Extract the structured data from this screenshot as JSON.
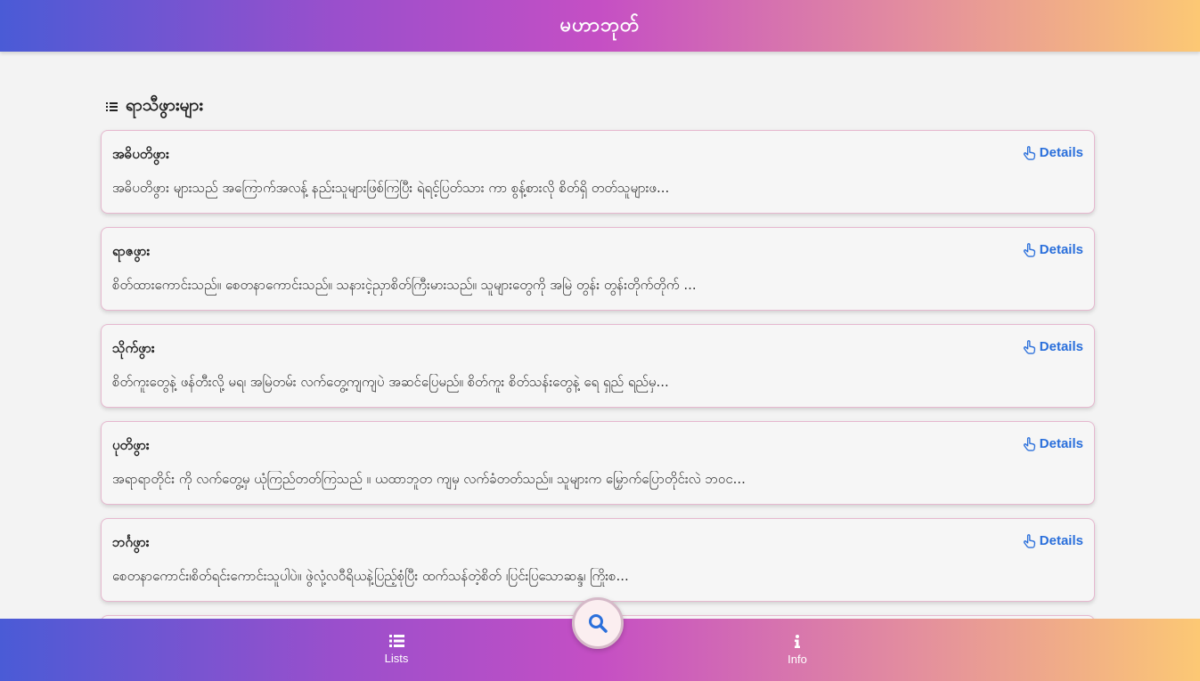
{
  "header": {
    "title": "မဟာဘုတ်"
  },
  "section": {
    "label": "ရာသီဖွားများ",
    "icon": "list-icon"
  },
  "cards": [
    {
      "title": "အဓိပတိဖွား",
      "description": "အဓိပတိဖွား များသည် အကြောက်အလန့် နည်းသူများဖြစ်ကြပြီး ရဲရင့်ပြတ်သား ကာ စွန့်စားလို စိတ်ရှိ တတ်သူများဖ...",
      "details_label": "Details"
    },
    {
      "title": "ရာဇဖွား",
      "description": "စိတ်ထားကောင်းသည်။ စေတနာကောင်းသည်။ သနားငဲ့ညှာစိတ်ကြီးမားသည်။ သူများတွေကို အမြဲ တွန်း တွန်းတိုက်တိုက် ...",
      "details_label": "Details"
    },
    {
      "title": "သိုက်ဖွား",
      "description": "စိတ်ကူးတွေနဲ့ ဖန်တီးလို့ မရ၊ အမြဲတမ်း လက်တွေ့ကျကျပဲ အဆင်ပြေမည်။ စိတ်ကူး စိတ်သန်းတွေနဲ့ ရေ ရှည် ရည်မှ...",
      "details_label": "Details"
    },
    {
      "title": "ပုတိဖွား",
      "description": "အရာရာတိုင်း ကို လက်တွေ့မှ ယုံကြည်တတ်ကြသည် ။ ယထာဘူတ ကျမှ လက်ခံတတ်သည်။ သူများက မြှောက်ပြောတိုင်းလဲ ဘဝင...",
      "details_label": "Details"
    },
    {
      "title": "ဘင်္ဂဖွား",
      "description": "စေတနာကောင်း၊စိတ်ရင်းကောင်းသူပါပဲ။ ဖွဲလုံ့လဝီရိယနဲ့ပြည့်စုံပြီး ထက်သန်တဲ့စိတ် ၊ပြင်းပြသောဆန္ဒ၊ ကြိုးစ...",
      "details_label": "Details"
    }
  ],
  "bottom_nav": {
    "lists_label": "Lists",
    "info_label": "Info",
    "search_icon": "search-icon"
  },
  "colors": {
    "accent": "#2a6fdb",
    "gradient_start": "#4a5bd6",
    "gradient_mid": "#c54fc4",
    "gradient_end": "#fcc874",
    "card_border": "#e6b8cf"
  }
}
